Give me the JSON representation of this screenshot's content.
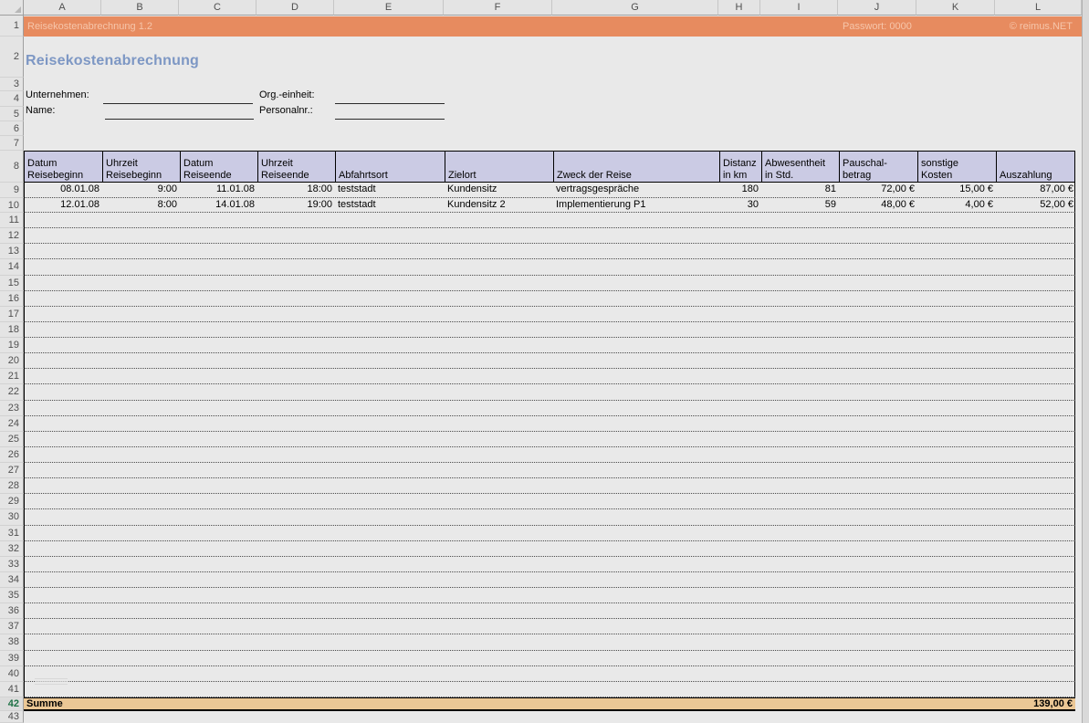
{
  "titlebar": {
    "title": "Reisekostenabrechnung 1.2",
    "password": "Passwort: 0000",
    "copyright": "© reimus.NET"
  },
  "heading": "Reisekostenabrechnung",
  "form": {
    "fields": [
      {
        "label": "Unternehmen:",
        "value": ""
      },
      {
        "label": "Org.-einheit:",
        "value": ""
      },
      {
        "label": "Name:",
        "value": ""
      },
      {
        "label": "Personalnr.:",
        "value": ""
      }
    ]
  },
  "grid": {
    "column_letters": [
      "A",
      "B",
      "C",
      "D",
      "E",
      "F",
      "G",
      "H",
      "I",
      "J",
      "K",
      "L"
    ],
    "row_numbers": [
      "1",
      "2",
      "3",
      "4",
      "5",
      "6",
      "7",
      "8",
      "9",
      "10",
      "11",
      "12",
      "13",
      "14",
      "15",
      "16",
      "17",
      "18",
      "19",
      "20",
      "21",
      "22",
      "23",
      "24",
      "25",
      "26",
      "27",
      "28",
      "29",
      "30",
      "31",
      "32",
      "33",
      "34",
      "35",
      "36",
      "37",
      "38",
      "39",
      "40",
      "41",
      "42",
      "43"
    ],
    "highlighted_row": "42"
  },
  "table": {
    "headers": [
      {
        "line1": "Datum",
        "line2": "Reisebeginn"
      },
      {
        "line1": "Uhrzeit",
        "line2": "Reisebeginn"
      },
      {
        "line1": "Datum",
        "line2": "Reiseende"
      },
      {
        "line1": "Uhrzeit",
        "line2": "Reiseende"
      },
      {
        "line1": "",
        "line2": "Abfahrtsort"
      },
      {
        "line1": "",
        "line2": "Zielort"
      },
      {
        "line1": "",
        "line2": "Zweck der Reise"
      },
      {
        "line1": "Distanz",
        "line2": "in km"
      },
      {
        "line1": "Abwesentheit",
        "line2": "in Std."
      },
      {
        "line1": "Pauschal-",
        "line2": "betrag"
      },
      {
        "line1": "sonstige",
        "line2": "Kosten"
      },
      {
        "line1": "",
        "line2": "Auszahlung"
      }
    ],
    "rows": [
      [
        "08.01.08",
        "9:00",
        "11.01.08",
        "18:00",
        "teststadt",
        "Kundensitz",
        "vertragsgespräche",
        "180",
        "81",
        "72,00 €",
        "15,00 €",
        "87,00 €"
      ],
      [
        "12.01.08",
        "8:00",
        "14.01.08",
        "19:00",
        "teststadt",
        "Kundensitz 2",
        "Implementierung P1",
        "30",
        "59",
        "48,00 €",
        "4,00 €",
        "52,00 €"
      ]
    ],
    "summary": {
      "label": "Summe",
      "total": "139,00 €"
    }
  },
  "colors": {
    "titlebar_bg": "#e78b5f",
    "titlebar_text": "#f6c6ab",
    "heading_text": "#7d97c4",
    "table_header_bg": "#cbcbe4",
    "summary_bg": "#ebc795",
    "highlight_row_number": "#1e7145",
    "sheet_bg": "#e9e9e9"
  }
}
